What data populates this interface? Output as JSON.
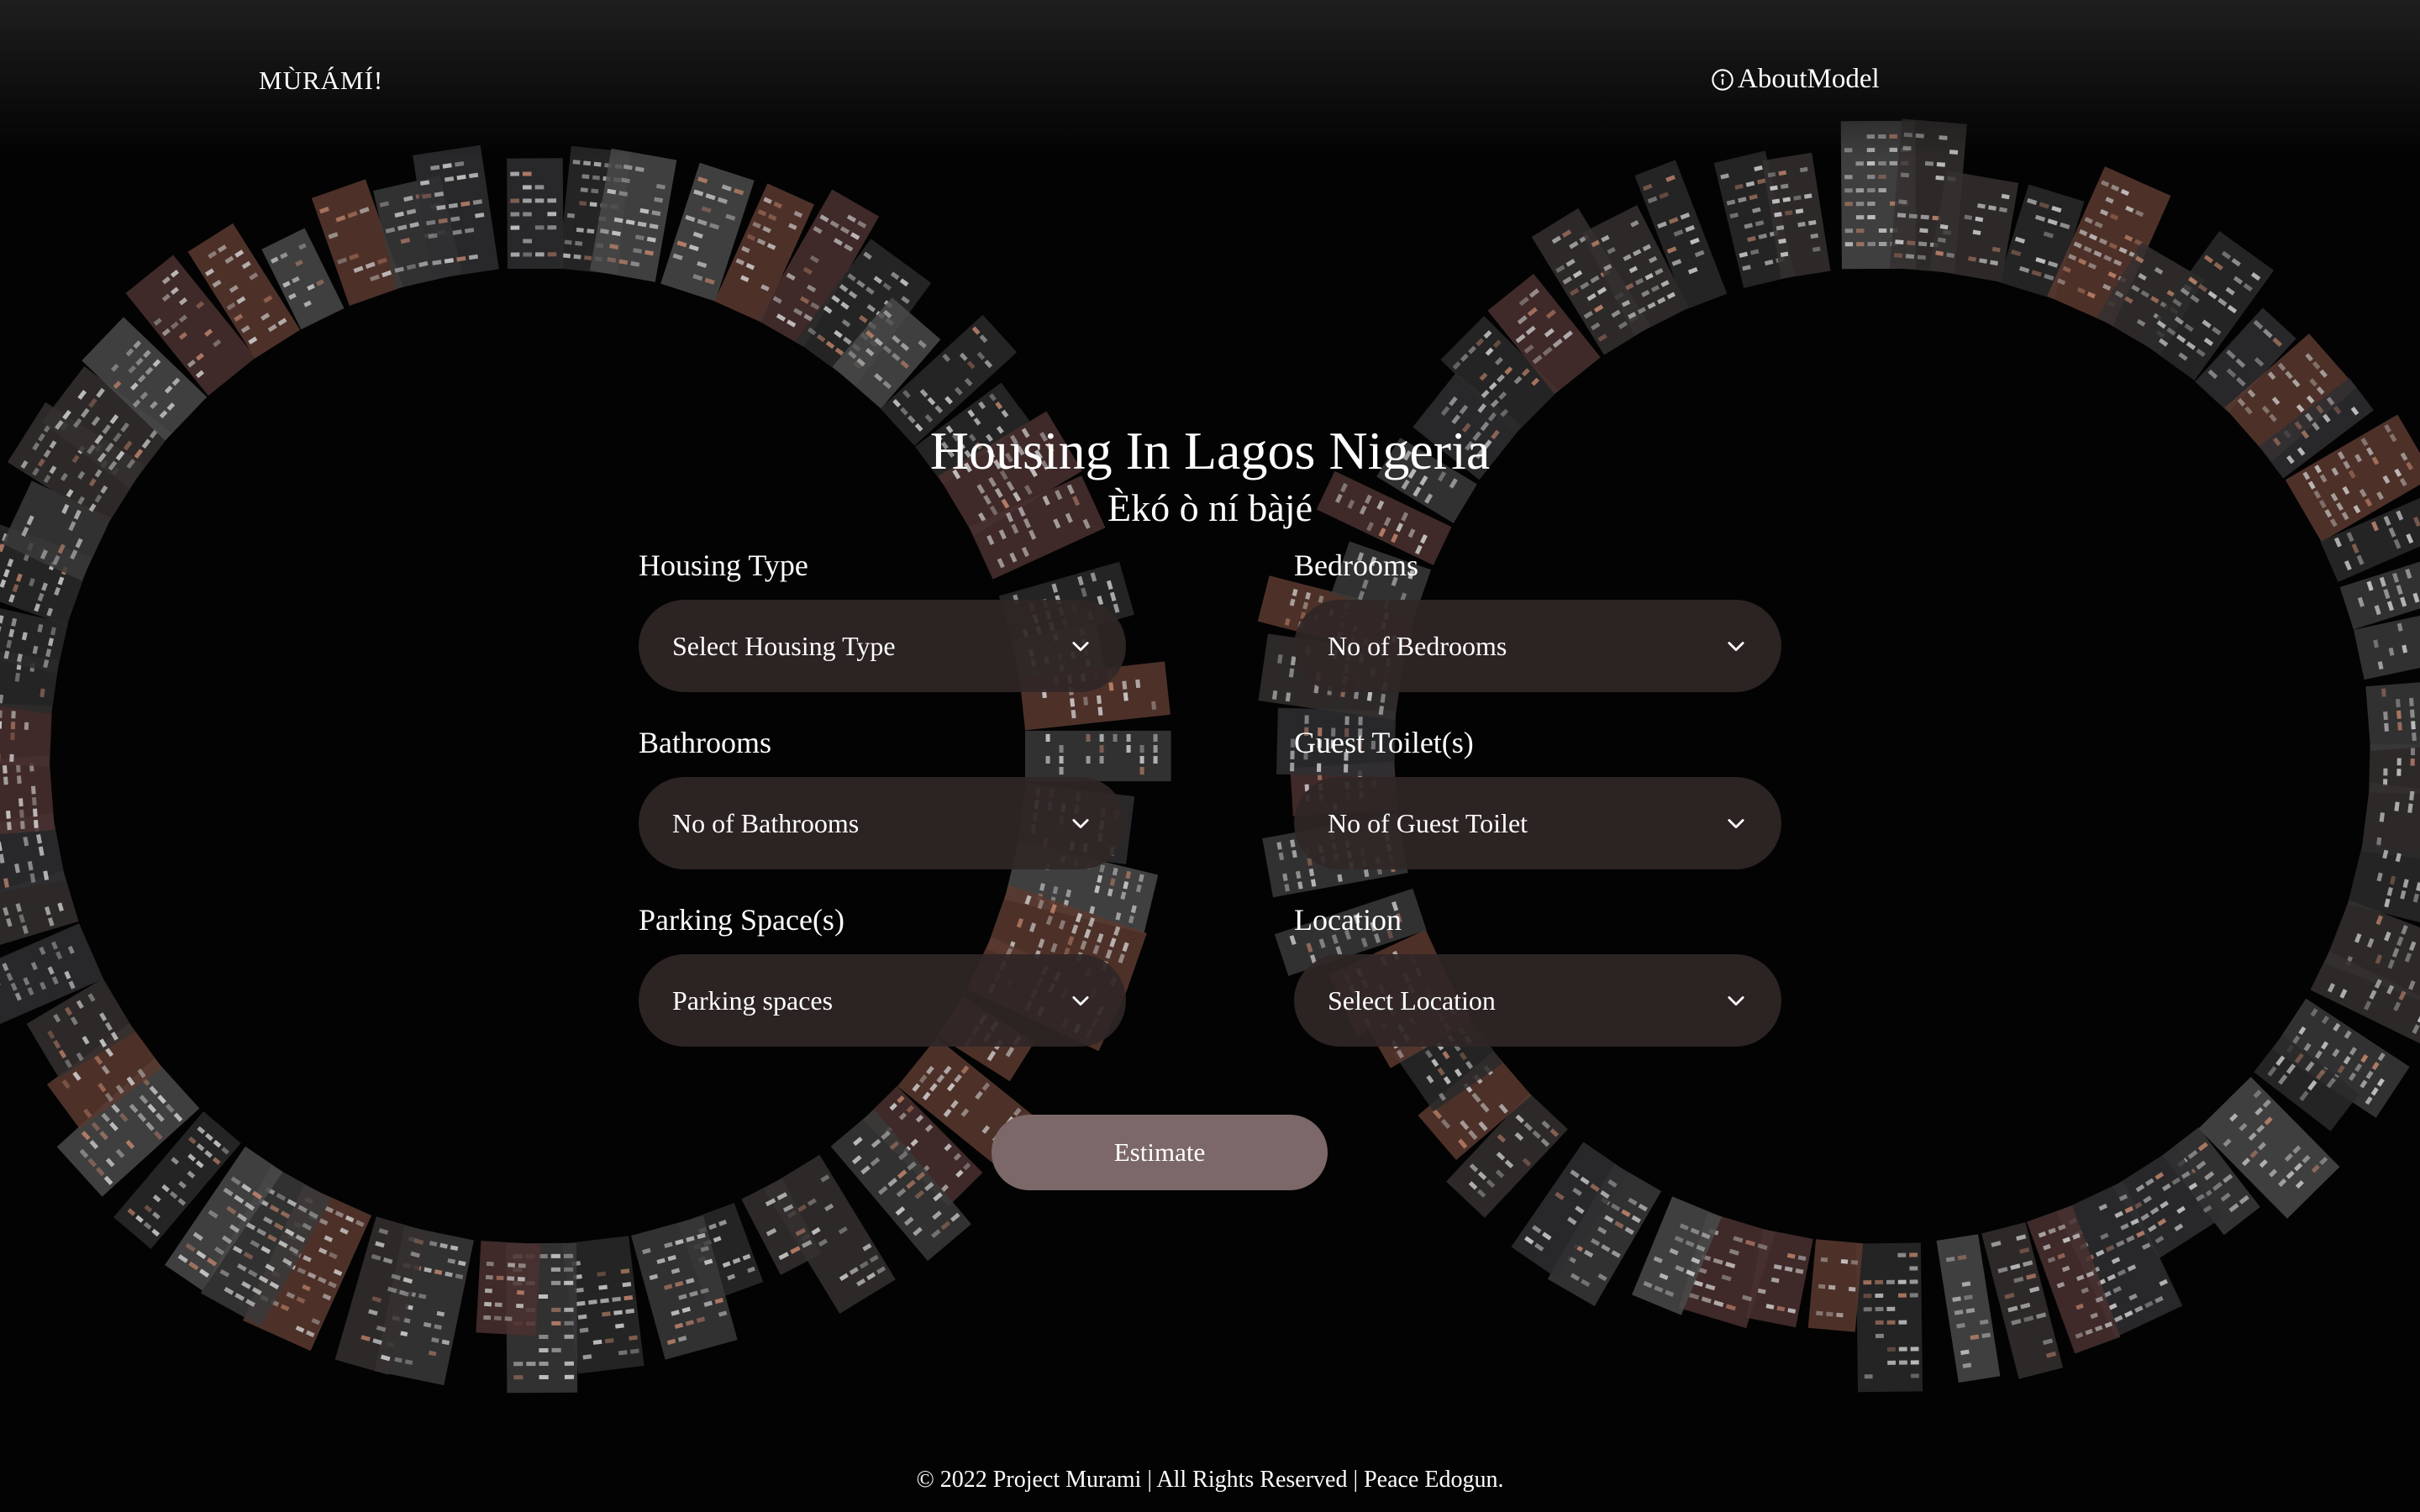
{
  "nav": {
    "brand": "MÙRÁMÍ!",
    "about_label": "AboutModel",
    "about_icon": "info-circle-icon"
  },
  "hero": {
    "title": "Housing In Lagos Nigeria",
    "subtitle": "Èkó ò ní bàjé"
  },
  "form": {
    "housing_type": {
      "label": "Housing Type",
      "placeholder": "Select Housing Type"
    },
    "bedrooms": {
      "label": "Bedrooms",
      "placeholder": "No of Bedrooms"
    },
    "bathrooms": {
      "label": "Bathrooms",
      "placeholder": "No of Bathrooms"
    },
    "guest_toilets": {
      "label": "Guest Toilet(s)",
      "placeholder": "No of Guest Toilet"
    },
    "parking": {
      "label": "Parking Space(s)",
      "placeholder": "Parking spaces"
    },
    "location": {
      "label": "Location",
      "placeholder": "Select Location"
    },
    "dropdown_icon": "chevron-down-icon",
    "estimate_label": "Estimate"
  },
  "footer": {
    "text": "© 2022 Project Murami | All Rights Reserved | Peace Edogun."
  },
  "colors": {
    "background": "#030303",
    "select_bg": "#302626",
    "button_bg": "#7c6868",
    "text": "#ffffff"
  }
}
